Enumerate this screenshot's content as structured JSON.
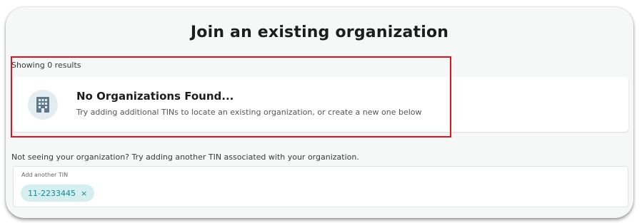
{
  "page": {
    "title": "Join an existing organization"
  },
  "results": {
    "count_label": "Showing 0 results",
    "empty_title": "No Organizations Found...",
    "empty_description": "Try adding additional TINs to locate an existing organization, or create a new one below",
    "icon": "building-icon"
  },
  "hint": "Not seeing your organization? Try adding another TIN associated with your organization.",
  "tin_field": {
    "label": "Add another TIN",
    "chips": [
      {
        "value": "11-2233445",
        "remove_glyph": "×"
      }
    ]
  },
  "colors": {
    "highlight": "#e0141f",
    "chip_bg": "#d5eef0",
    "chip_text": "#0f8a93",
    "icon_bg": "#e3ecf1"
  }
}
